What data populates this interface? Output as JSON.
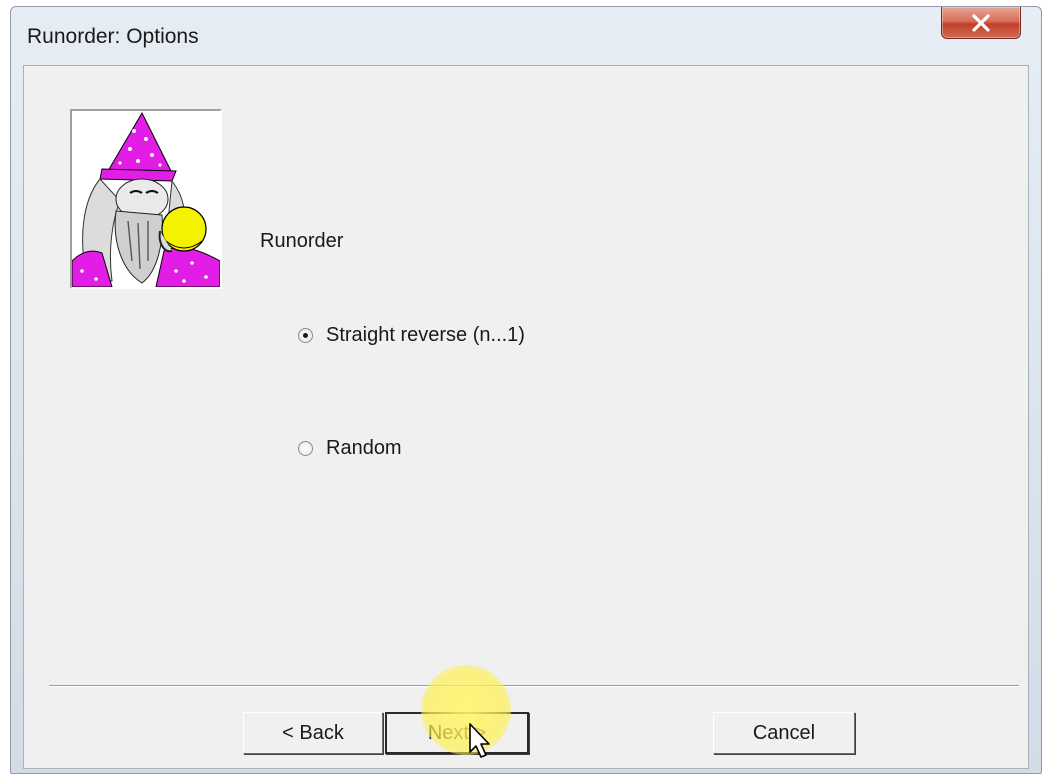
{
  "window": {
    "title": "Runorder: Options",
    "close_icon": "close-icon"
  },
  "page": {
    "heading": "Runorder",
    "wizard_image": "wizard-illustration"
  },
  "options": [
    {
      "label": "Straight reverse (n...1)",
      "selected": true
    },
    {
      "label": "Random",
      "selected": false
    }
  ],
  "buttons": {
    "back": "< Back",
    "next": "Next >",
    "cancel": "Cancel"
  },
  "colors": {
    "wizard_magenta": "#e21ee6",
    "wizard_yellow": "#f5f200",
    "close_red": "#c9452f"
  }
}
